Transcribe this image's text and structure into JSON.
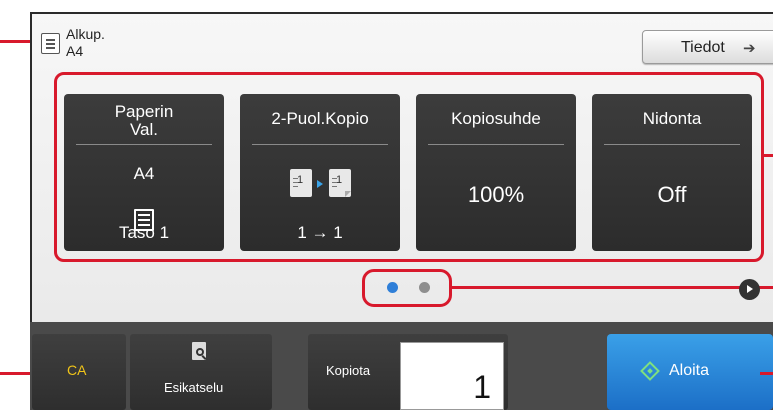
{
  "header": {
    "original_label": "Alkup.",
    "original_size": "A4",
    "info_button": "Tiedot",
    "info_arrow_icon": "arrow-right-icon"
  },
  "function_keys": [
    {
      "title": "Paperin Val.",
      "value": "A4",
      "subvalue": "Taso 1",
      "icon": "paper-tray-icon"
    },
    {
      "title": "2-Puol.Kopio",
      "value": "1 → 1",
      "icon": "duplex-copy-icon"
    },
    {
      "title": "Kopiosuhde",
      "value": "100%"
    },
    {
      "title": "Nidonta",
      "value": "Off"
    }
  ],
  "pager": {
    "active_page": 1,
    "total_pages": 2,
    "active_color": "#2f7fd8",
    "inactive_color": "#8e8e8e"
  },
  "bottom": {
    "ca_label": "CA",
    "preview_label": "Esikatselu",
    "copies_label": "Kopiota",
    "copies_value": "1",
    "start_label": "Aloita"
  },
  "colors": {
    "callout": "#d8192c",
    "ca_text": "#f0c419",
    "start_button": "#2a86d8"
  }
}
